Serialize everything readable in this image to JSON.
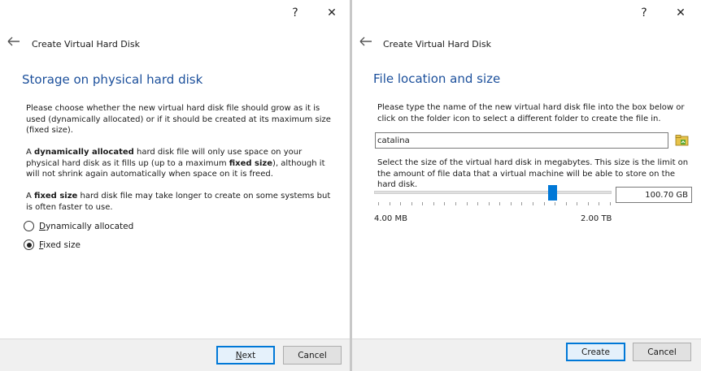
{
  "titlebar": {
    "help_label": "?",
    "close_label": "✕"
  },
  "storage_dialog": {
    "wizard_title": "Create Virtual Hard Disk",
    "page_title": "Storage on physical hard disk",
    "para1": "Please choose whether the new virtual hard disk file should grow as it is used (dynamically allocated) or if it should be created at its maximum size (fixed size).",
    "para2_prefix": "A ",
    "para2_bold1": "dynamically allocated",
    "para2_mid": " hard disk file will only use space on your physical hard disk as it fills up (up to a maximum ",
    "para2_bold2": "fixed size",
    "para2_suffix": "), although it will not shrink again automatically when space on it is freed.",
    "para3_prefix": "A ",
    "para3_bold": "fixed size",
    "para3_suffix": " hard disk file may take longer to create on some systems but is often faster to use.",
    "options": [
      {
        "mnemonic": "D",
        "rest": "ynamically allocated",
        "checked": false
      },
      {
        "mnemonic": "F",
        "rest": "ixed size",
        "checked": true
      }
    ],
    "next_mnemonic": "N",
    "next_rest": "ext",
    "cancel_label": "Cancel"
  },
  "location_dialog": {
    "wizard_title": "Create Virtual Hard Disk",
    "page_title": "File location and size",
    "location_text": "Please type the name of the new virtual hard disk file into the box below or click on the folder icon to select a different folder to create the file in.",
    "file_name": "catalina",
    "size_text": "Select the size of the virtual hard disk in megabytes. This size is the limit on the amount of file data that a virtual machine will be able to store on the hard disk.",
    "slider_fraction": 0.75,
    "size_value": "100.70 GB",
    "min_label": "4.00 MB",
    "max_label": "2.00 TB",
    "create_label": "Create",
    "cancel_label": "Cancel"
  }
}
